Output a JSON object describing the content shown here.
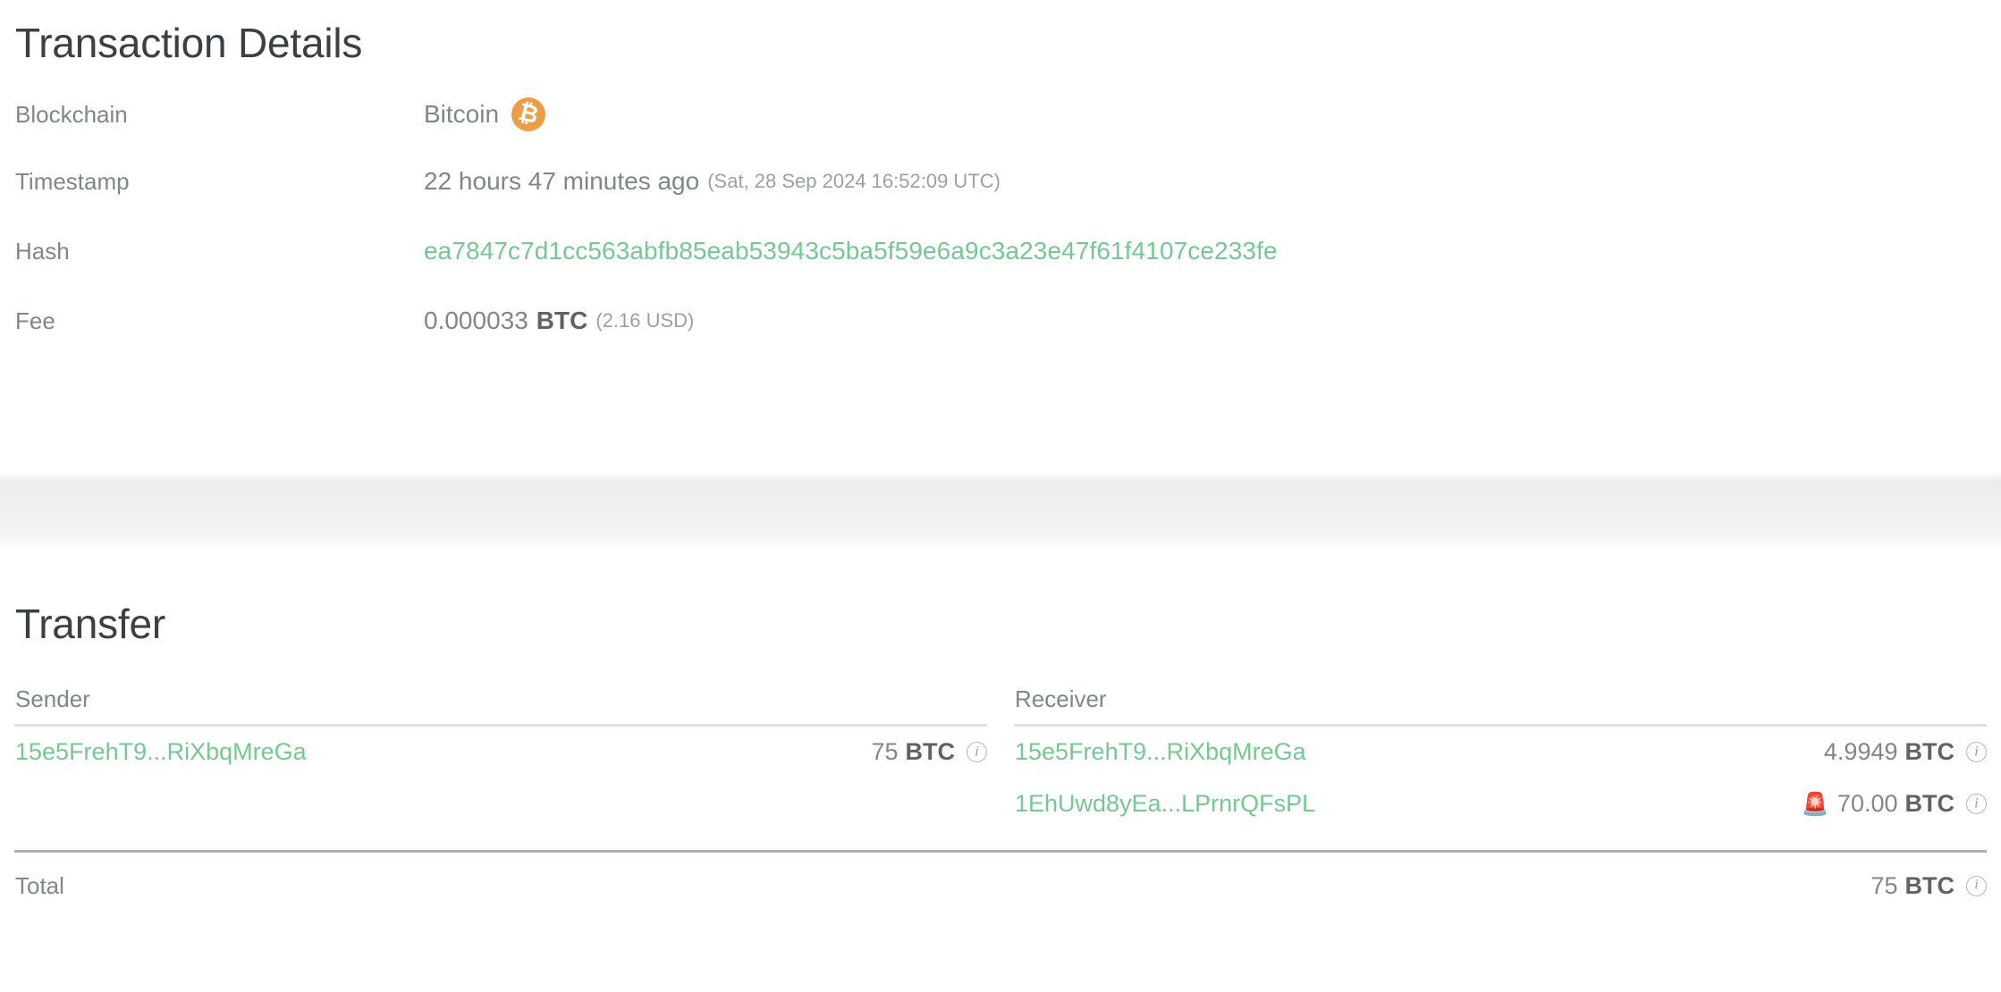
{
  "details": {
    "title": "Transaction Details",
    "rows": [
      {
        "label": "Blockchain",
        "value": "Bitcoin",
        "icon": "bitcoin-icon"
      },
      {
        "label": "Timestamp",
        "value": "22 hours 47 minutes ago",
        "secondary": "(Sat, 28 Sep 2024 16:52:09 UTC)"
      },
      {
        "label": "Hash",
        "value": "ea7847c7d1cc563abfb85eab53943c5ba5f59e6a9c3a23e47f61f4107ce233fe"
      },
      {
        "label": "Fee",
        "value": "0.000033",
        "unit": "BTC",
        "secondary": "(2.16 USD)"
      }
    ]
  },
  "transfer": {
    "title": "Transfer",
    "sender": {
      "header": "Sender",
      "rows": [
        {
          "address": "15e5FrehT9...RiXbqMreGa",
          "amount": "75",
          "unit": "BTC",
          "info_icon": "info-icon",
          "alert_icon": ""
        }
      ]
    },
    "receiver": {
      "header": "Receiver",
      "rows": [
        {
          "address": "15e5FrehT9...RiXbqMreGa",
          "amount": "4.9949",
          "unit": "BTC",
          "info_icon": "info-icon",
          "alert_icon": ""
        },
        {
          "address": "1EhUwd8yEa...LPrnrQFsPL",
          "amount": "70.00",
          "unit": "BTC",
          "info_icon": "info-icon",
          "alert_icon": "🚨"
        }
      ]
    },
    "total": {
      "label": "Total",
      "amount": "75",
      "unit": "BTC",
      "info_icon": "info-icon"
    }
  },
  "colors": {
    "link_green": "#76c893",
    "bitcoin_orange": "#eb9e46",
    "label_gray": "#80868b",
    "heading_dark": "#3c4043"
  }
}
